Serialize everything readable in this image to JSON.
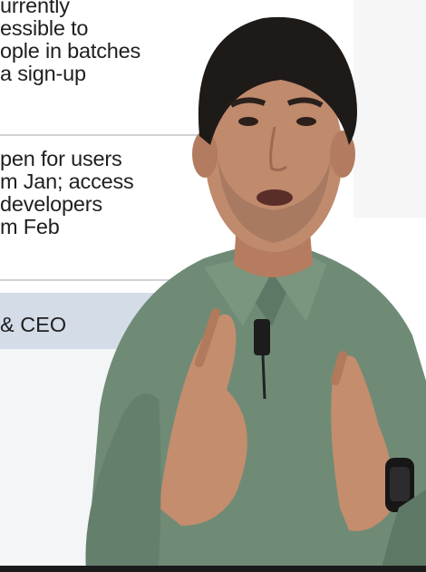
{
  "card": {
    "block1": "urrently\nessible to\nople in batches\na sign-up",
    "block2": "pen for users\nm Jan; access\ndevelopers\nm Feb",
    "role_label": "& CEO"
  },
  "colors": {
    "shirt": "#6f8b76",
    "hair": "#1e1a18",
    "skin": "#c08a6c",
    "panel_blue": "#d4dce8",
    "bottom_bar": "#1b1b1b"
  },
  "icons": [
    "lapel-mic-icon",
    "smartwatch-icon"
  ]
}
